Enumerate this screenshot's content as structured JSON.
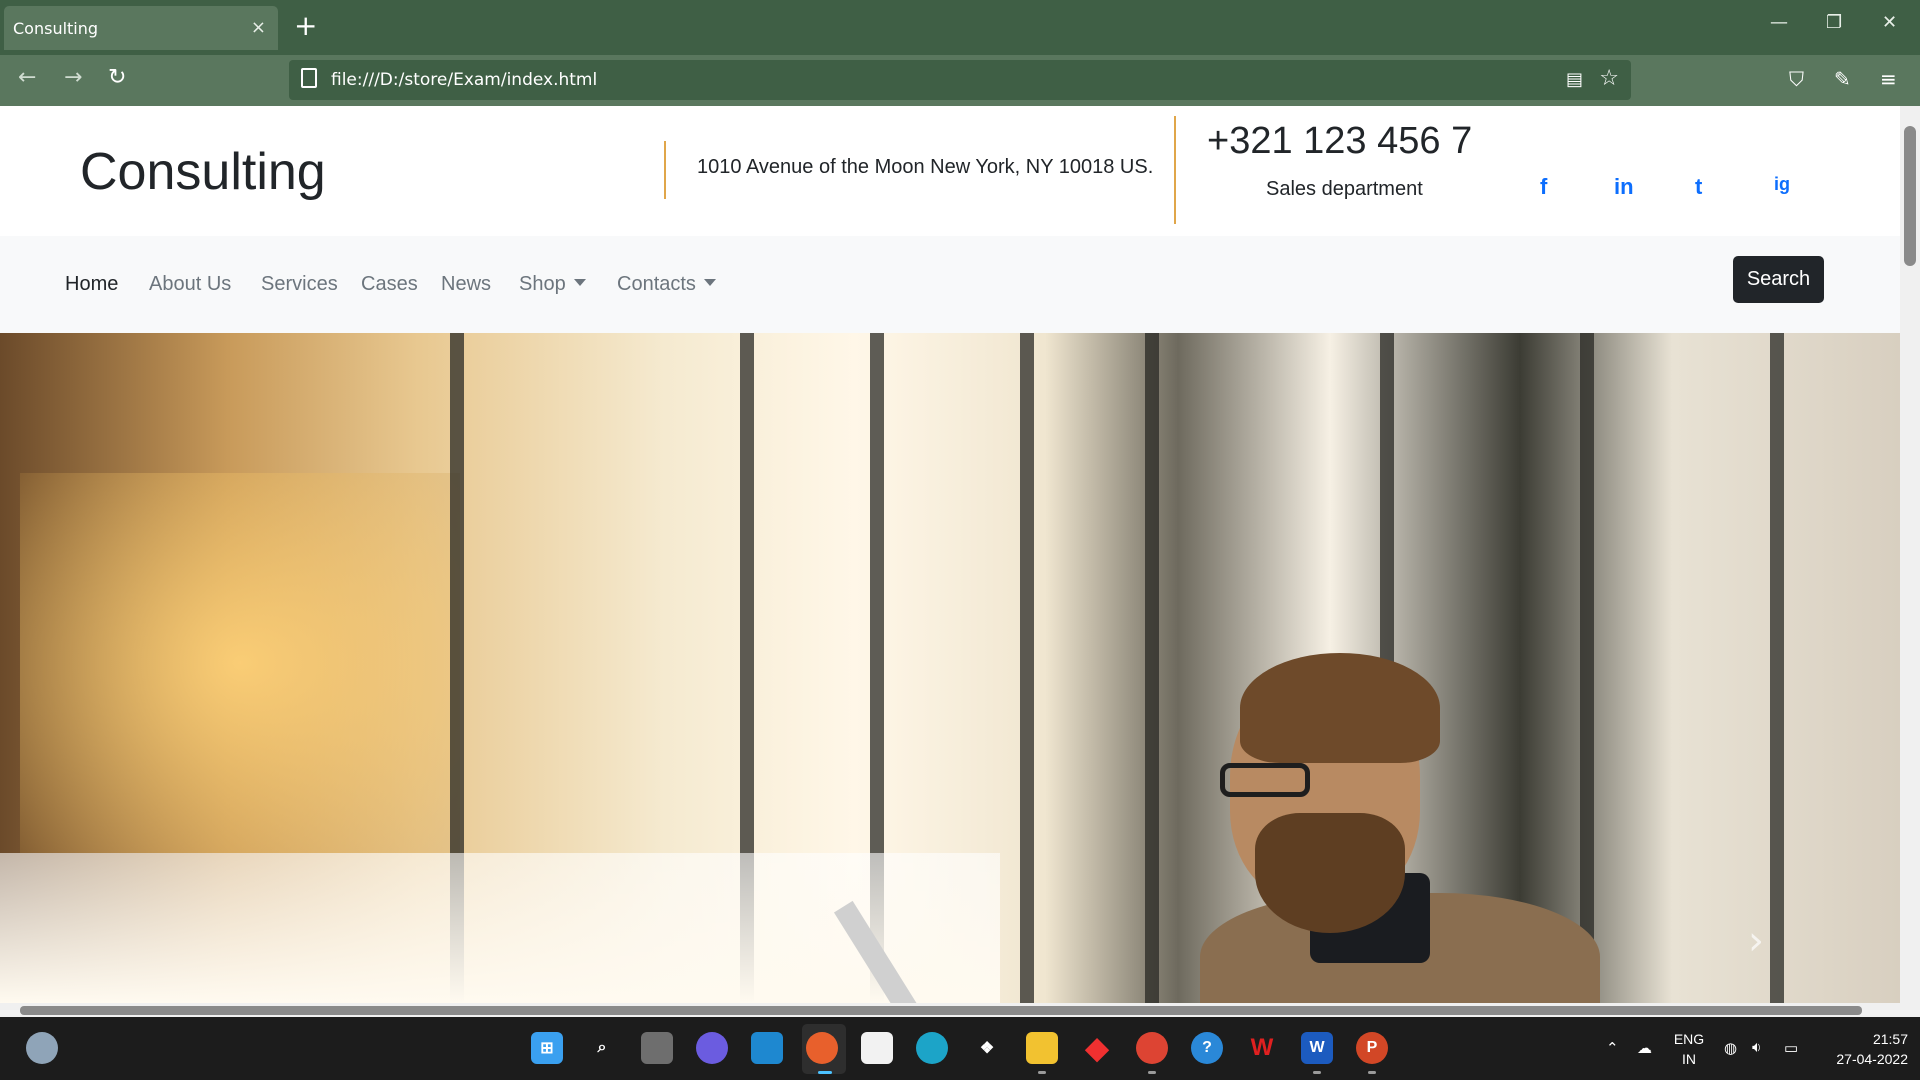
{
  "browser": {
    "tab_title": "Consulting",
    "tab_close": "×",
    "new_tab": "+",
    "url": "file:///D:/store/Exam/index.html",
    "win_min": "—",
    "win_restore": "❐",
    "win_close": "✕"
  },
  "header": {
    "brand": "Consulting",
    "address": "1010 Avenue of the Moon New York, NY 10018 US.",
    "phone": "+321 123 456 7",
    "department": "Sales department",
    "social": [
      "f",
      "in",
      "t",
      "ig"
    ]
  },
  "nav": {
    "items": [
      {
        "label": "Home"
      },
      {
        "label": "About Us"
      },
      {
        "label": "Services"
      },
      {
        "label": "Cases"
      },
      {
        "label": "News"
      },
      {
        "label": "Shop"
      },
      {
        "label": "Contacts"
      }
    ],
    "search_label": "Search"
  },
  "hero": {
    "next_glyph": "›"
  },
  "taskbar": {
    "lang_top": "ENG",
    "lang_bottom": "IN",
    "time": "21:57",
    "date": "27-04-2022"
  },
  "colors": {
    "accent": "#e0a64a",
    "link": "#0d6efd",
    "browser_dark": "#3f5f45",
    "browser_light": "#5a775e"
  }
}
